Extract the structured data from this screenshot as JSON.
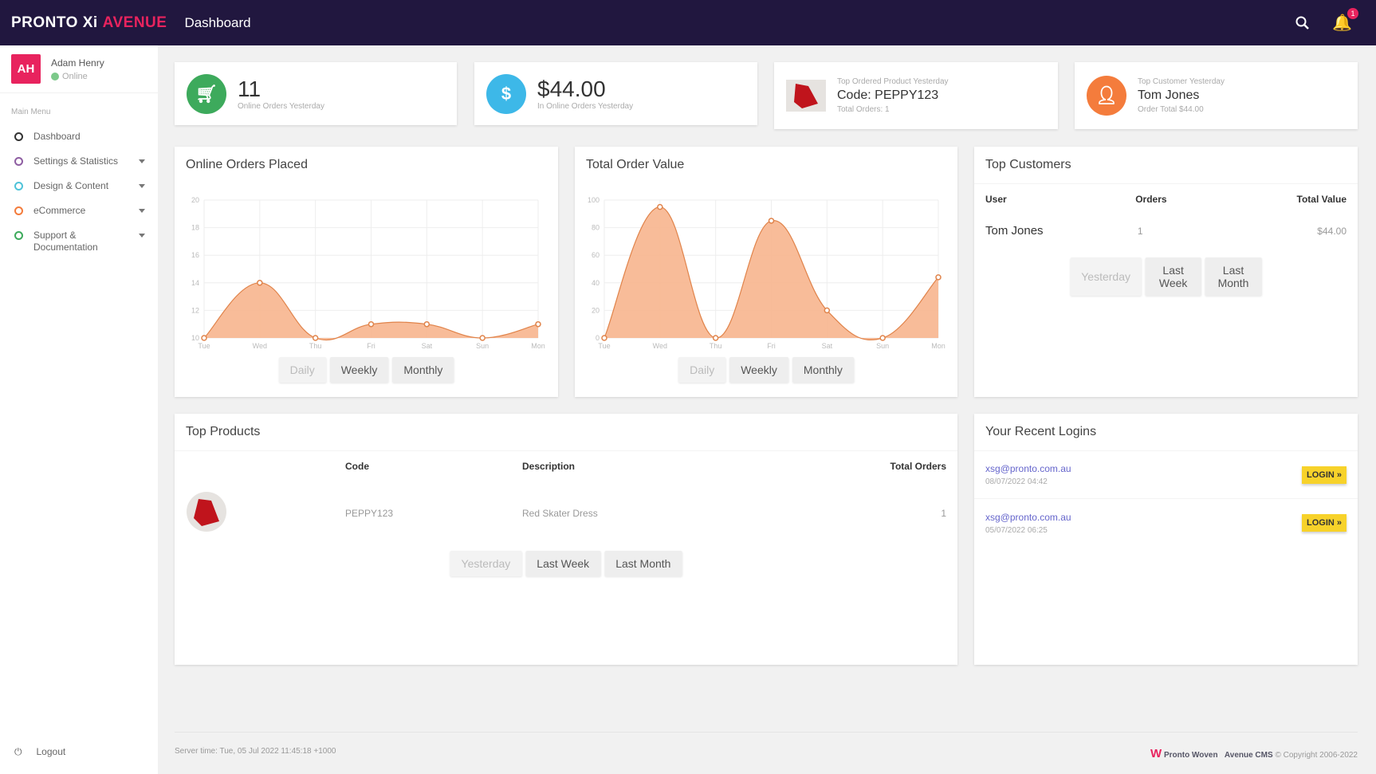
{
  "header": {
    "logo_main": "PRONTO Xi",
    "logo_accent": "AVENUE",
    "title": "Dashboard",
    "notifications": "1"
  },
  "user": {
    "initials": "AH",
    "name": "Adam Henry",
    "status": "Online"
  },
  "sidebar": {
    "heading": "Main Menu",
    "items": [
      {
        "label": "Dashboard",
        "color": "#333333",
        "caret": false
      },
      {
        "label": "Settings & Statistics",
        "color": "#8e5ea2",
        "caret": true
      },
      {
        "label": "Design & Content",
        "color": "#4fc3d9",
        "caret": true
      },
      {
        "label": "eCommerce",
        "color": "#f47c3c",
        "caret": true
      },
      {
        "label": "Support & Documentation",
        "color": "#3daa5c",
        "caret": true
      }
    ],
    "logout": "Logout"
  },
  "stats": [
    {
      "value": "11",
      "label": "Online Orders Yesterday",
      "icon": "cart-icon",
      "color": "#3daa5c"
    },
    {
      "value": "$44.00",
      "label": "In Online Orders Yesterday",
      "icon": "dollar-icon",
      "color": "#3db8e8"
    },
    {
      "caption": "Top Ordered Product Yesterday",
      "value": "Code: PEPPY123",
      "sub": "Total Orders: 1"
    },
    {
      "caption": "Top Customer Yesterday",
      "value": "Tom Jones",
      "sub": "Order Total $44.00",
      "color": "#f47c3c"
    }
  ],
  "range_buttons": {
    "daily": "Daily",
    "weekly": "Weekly",
    "monthly": "Monthly",
    "yesterday": "Yesterday",
    "last_week": "Last Week",
    "last_month": "Last Month"
  },
  "chart_data": [
    {
      "type": "area",
      "title": "Online Orders Placed",
      "categories": [
        "Tue",
        "Wed",
        "Thu",
        "Fri",
        "Sat",
        "Sun",
        "Mon"
      ],
      "values": [
        10,
        14,
        10,
        11,
        11,
        10,
        11
      ],
      "yticks": [
        10,
        12,
        14,
        16,
        18,
        20
      ],
      "ylim": [
        10,
        20
      ],
      "grid": true,
      "color": "#f7b58e"
    },
    {
      "type": "area",
      "title": "Total Order Value",
      "categories": [
        "Tue",
        "Wed",
        "Thu",
        "Fri",
        "Sat",
        "Sun",
        "Mon"
      ],
      "values": [
        0,
        95,
        0,
        85,
        20,
        0,
        44
      ],
      "yticks": [
        0,
        20,
        40,
        60,
        80,
        100
      ],
      "ylim": [
        0,
        100
      ],
      "grid": true,
      "color": "#f7b58e"
    }
  ],
  "top_customers": {
    "title": "Top Customers",
    "columns": [
      "User",
      "Orders",
      "Total Value"
    ],
    "rows": [
      {
        "user": "Tom Jones",
        "orders": "1",
        "total": "$44.00"
      }
    ]
  },
  "top_products": {
    "title": "Top Products",
    "columns": [
      "",
      "Code",
      "Description",
      "Total Orders"
    ],
    "rows": [
      {
        "code": "PEPPY123",
        "description": "Red Skater Dress",
        "orders": "1"
      }
    ]
  },
  "recent_logins": {
    "title": "Your Recent Logins",
    "button": "LOGIN »",
    "rows": [
      {
        "email": "xsg@pronto.com.au",
        "time": "08/07/2022 04:42"
      },
      {
        "email": "xsg@pronto.com.au",
        "time": "05/07/2022 06:25"
      }
    ]
  },
  "footer": {
    "server_time": "Server time: Tue, 05 Jul 2022 11:45:18 +1000",
    "brand": "Pronto Woven",
    "cms": "Avenue CMS",
    "copyright": "© Copyright 2006-2022"
  }
}
